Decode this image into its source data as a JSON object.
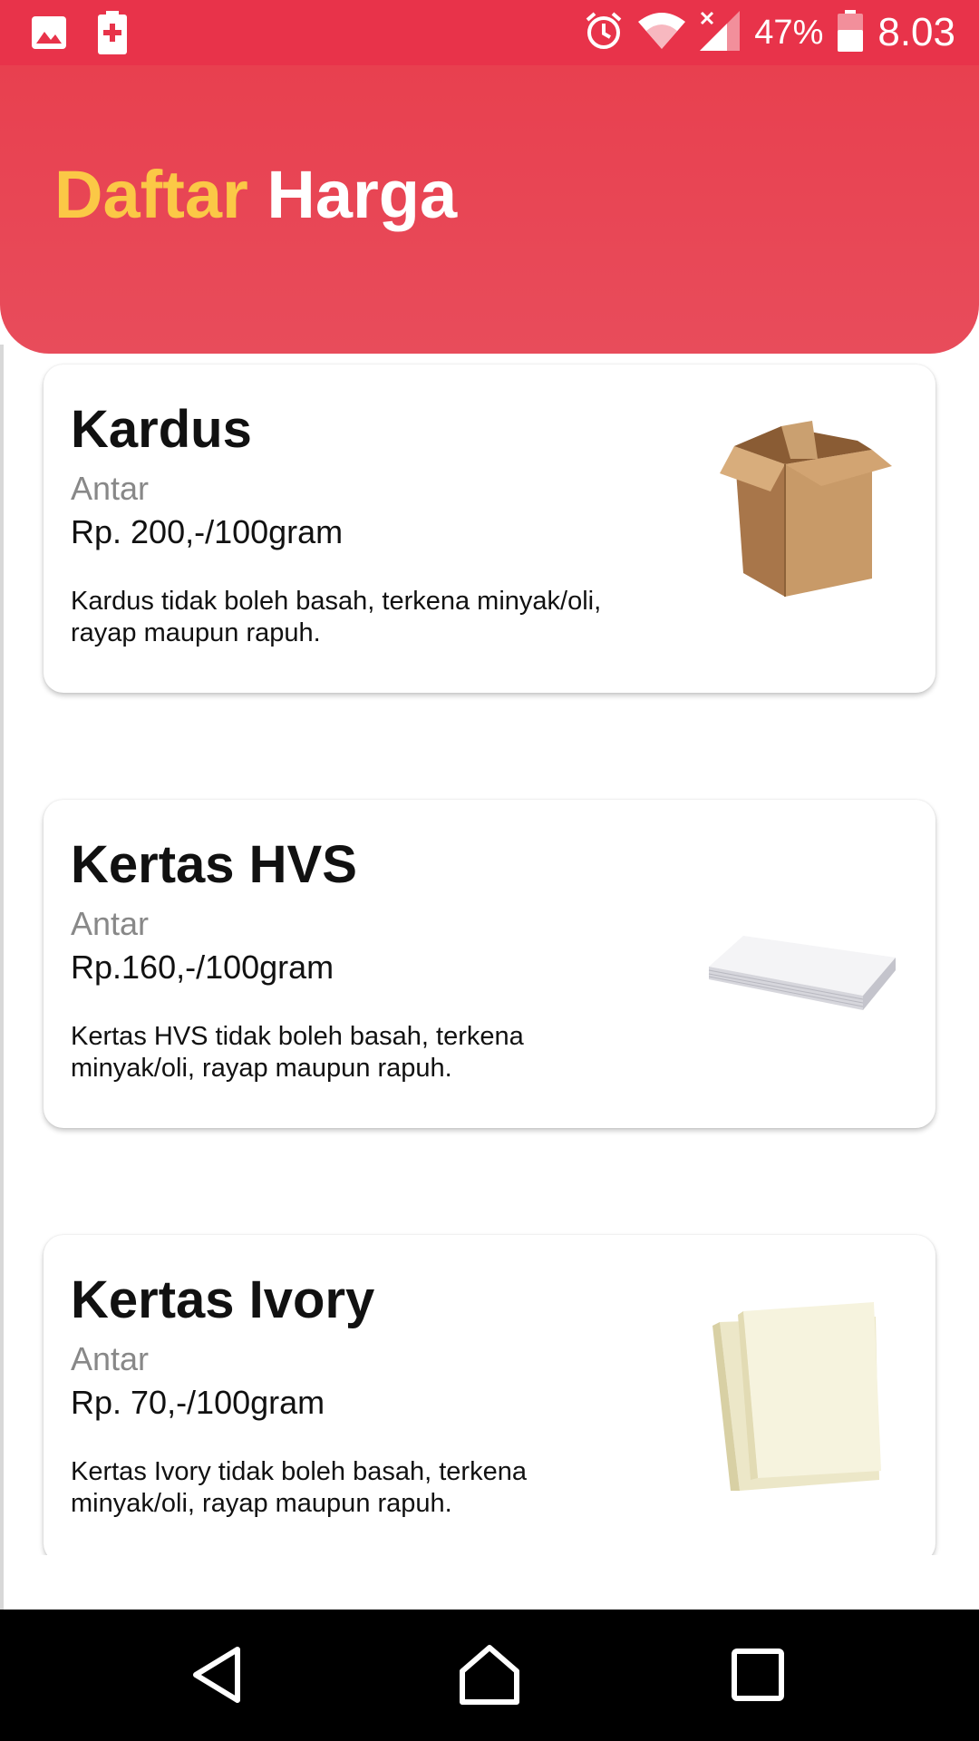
{
  "status_bar": {
    "battery_percent": "47%",
    "time": "8.03",
    "icons": [
      "image-icon",
      "battery-saver-icon",
      "alarm-icon",
      "wifi-icon",
      "signal-icon",
      "battery-icon"
    ]
  },
  "header": {
    "title_part1": "Daftar",
    "title_part2": "Harga",
    "colors": {
      "background": "#e8404f",
      "title_accent": "#fbc846",
      "title_main": "#ffffff"
    }
  },
  "items": [
    {
      "name": "Kardus",
      "mode": "Antar",
      "price": "Rp. 200,-/100gram",
      "description": "Kardus tidak boleh basah, terkena minyak/oli, rayap maupun rapuh.",
      "image_icon": "cardboard-box-image"
    },
    {
      "name": "Kertas HVS",
      "mode": "Antar",
      "price": "Rp.160,-/100gram",
      "description": "Kertas HVS tidak boleh basah, terkena minyak/oli, rayap maupun rapuh.",
      "image_icon": "paper-stack-image"
    },
    {
      "name": "Kertas Ivory",
      "mode": "Antar",
      "price": "Rp. 70,-/100gram",
      "description": "Kertas Ivory tidak boleh basah, terkena minyak/oli, rayap maupun rapuh.",
      "image_icon": "ivory-paper-image"
    }
  ],
  "nav_bar": {
    "icons": [
      "back-icon",
      "home-icon",
      "recents-icon"
    ]
  }
}
